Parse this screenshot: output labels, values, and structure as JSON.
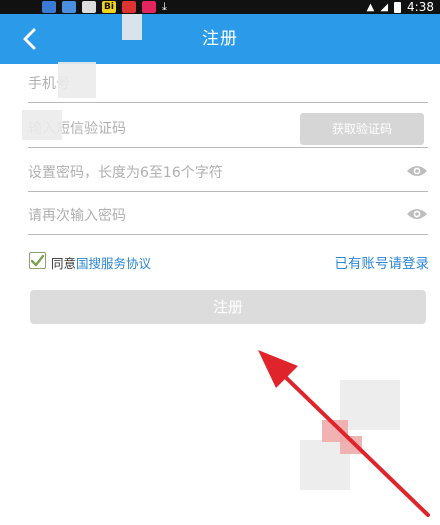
{
  "status_bar": {
    "time": "4:38",
    "icons": [
      "notification-icon",
      "sync-icon",
      "app-icon",
      "bi-icon",
      "app2-icon",
      "pinterest-icon",
      "download-icon",
      "wifi-icon",
      "signal-icon",
      "battery-icon"
    ],
    "app_badge": "Bi"
  },
  "nav": {
    "title": "注册",
    "back_icon": "chevron-left-icon"
  },
  "form": {
    "phone_placeholder": "手机号",
    "sms_placeholder": "输入短信验证码",
    "get_code_label": "获取验证码",
    "password_placeholder": "设置密码，长度为6至16个字符",
    "confirm_placeholder": "请再次输入密码"
  },
  "agreement": {
    "prefix": "同意",
    "link": "国搜服务协议",
    "checked": true,
    "login_link": "已有账号请登录"
  },
  "submit": {
    "label": "注册"
  },
  "colors": {
    "nav": "#2b9ae8",
    "link": "#2b86d4",
    "disabled_button": "#dcdcdc",
    "arrow": "#e0242c"
  }
}
